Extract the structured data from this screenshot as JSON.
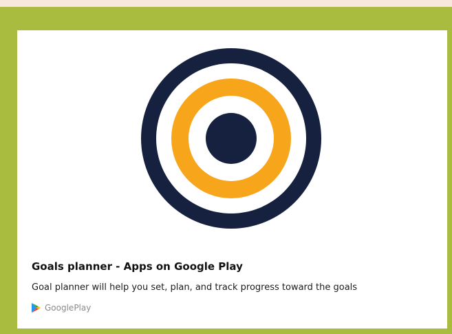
{
  "card": {
    "title": "Goals planner - Apps on Google Play",
    "description": "Goal planner will help you set, plan, and track progress toward the goals",
    "source": "GooglePlay",
    "source_icon": "google-play-icon"
  },
  "image": {
    "icon": "target-icon",
    "colors": {
      "outer_ring": "#15213f",
      "inner_ring": "#f7a51b",
      "bullseye": "#15213f",
      "gap": "#ffffff"
    }
  },
  "colors": {
    "frame": "#aabc3f",
    "background": "#f7e7dc"
  }
}
